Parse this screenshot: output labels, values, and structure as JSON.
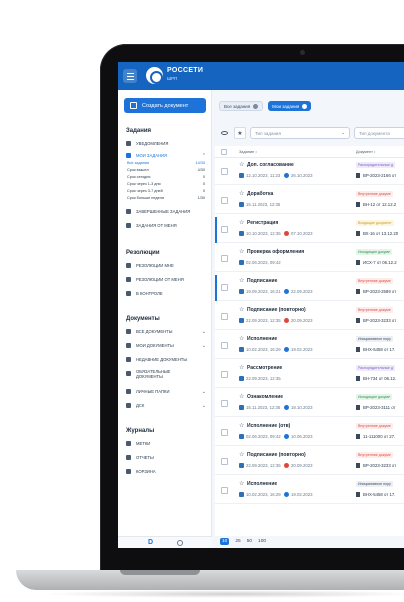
{
  "app": {
    "logo_text": "РОССЕТИ",
    "logo_sub": "ШРП"
  },
  "sidebar": {
    "create_label": "Создать документ",
    "tasks_title": "Задания",
    "notifications": "Уведомления",
    "my_tasks": "Мои задания",
    "subitems": [
      {
        "label": "Все задания",
        "count": "14/33"
      },
      {
        "label": "Срок вышел",
        "count": "4/30"
      },
      {
        "label": "Срок сегодня",
        "count": "0"
      },
      {
        "label": "Срок через 1-3 дня",
        "count": "0"
      },
      {
        "label": "Срок через 3-7 дней",
        "count": "0"
      },
      {
        "label": "Срок больше недели",
        "count": "1/30"
      }
    ],
    "completed_tasks": "Завершенные задания",
    "tasks_from_me": "Задания от меня",
    "resolutions_title": "Резолюции",
    "resolutions_to_me": "Резолюции мне",
    "resolutions_from_me": "Резолюции от меня",
    "on_control": "В контроле",
    "documents_title": "Документы",
    "all_documents": "Все документы",
    "my_documents": "Мои документы",
    "recent_documents": "Недавние документы",
    "mandatory_documents": "Обязательные документы",
    "personal_folders": "Личные папки",
    "dsk": "ДСК",
    "journals_title": "Журналы",
    "marks": "Метки",
    "reports": "Отчеты",
    "trash": "Корзина",
    "footer_letter": "D"
  },
  "main": {
    "chips": [
      {
        "label": "Все задания"
      },
      {
        "label": "Мои задания"
      }
    ],
    "task_type_placeholder": "Тип задания",
    "doc_type_placeholder": "Тип документа",
    "col_task": "Задание",
    "col_document": "Документ",
    "rows": [
      {
        "title": "Доп. согласование",
        "date": "12.10.2023, 11:23",
        "deadline": "26.10.2023",
        "deadline_color": "#1e73d8",
        "tag": "Распорядительные д",
        "tag_color": "#7b5fc7",
        "tag_bg": "#efeaf9",
        "doc": "ВР-2023-2166 от",
        "marked": false
      },
      {
        "title": "Доработка",
        "date": "15.11.2023, 12:35",
        "deadline": "",
        "deadline_color": "",
        "tag": "Внутренние докуме",
        "tag_color": "#d9503f",
        "tag_bg": "#fdeceb",
        "doc": "ВН-12 от 12.12.2",
        "marked": false
      },
      {
        "title": "Регистрация",
        "date": "10.10.2023, 12:35",
        "deadline": "07.10.2023",
        "deadline_color": "#e0463a",
        "tag": "Входящие документ",
        "tag_color": "#c9a227",
        "tag_bg": "#fbf5e1",
        "doc": "ВХ-16 от 13.12.20",
        "marked": true
      },
      {
        "title": "Проверка оформления",
        "date": "02.06.2023, 09:42",
        "deadline": "",
        "deadline_color": "",
        "tag": "Исходящие докуме",
        "tag_color": "#2f8f4e",
        "tag_bg": "#e6f5ea",
        "doc": "ИСХ-7 от 06.12.2",
        "marked": false
      },
      {
        "title": "Подписание",
        "date": "19.09.2023, 16:21",
        "deadline": "22.09.2023",
        "deadline_color": "#1e73d8",
        "tag": "Внутренние докуме",
        "tag_color": "#d9503f",
        "tag_bg": "#fdeceb",
        "doc": "ВР-2023-2589 от",
        "marked": true
      },
      {
        "title": "Подписание (повторно)",
        "date": "22.09.2023, 12:35",
        "deadline": "20.09.2023",
        "deadline_color": "#e0463a",
        "tag": "Внутренние докуме",
        "tag_color": "#d9503f",
        "tag_bg": "#fdeceb",
        "doc": "ВР-2023-3233 от",
        "marked": false
      },
      {
        "title": "Исполнение",
        "date": "10.02.2023, 16:29",
        "deadline": "19.02.2023",
        "deadline_color": "#1e73d8",
        "tag": "Инициативное пору",
        "tag_color": "#3a4a5c",
        "tag_bg": "#eceff3",
        "doc": "ВНХ-5458 от 17.",
        "marked": false
      },
      {
        "title": "Рассмотрение",
        "date": "22.09.2023, 12:35",
        "deadline": "",
        "deadline_color": "",
        "tag": "Распорядительные д",
        "tag_color": "#7b5fc7",
        "tag_bg": "#efeaf9",
        "doc": "ВН-734 от 06.12.",
        "marked": false
      },
      {
        "title": "Ознакомление",
        "date": "15.11.2023, 12:35",
        "deadline": "18.10.2023",
        "deadline_color": "#1e73d8",
        "tag": "Исходящие докуме",
        "tag_color": "#2f8f4e",
        "tag_bg": "#e6f5ea",
        "doc": "ВР-2023-3111 от",
        "marked": false
      },
      {
        "title": "Исполнение (отв)",
        "date": "02.06.2023, 09:42",
        "deadline": "10.06.2023",
        "deadline_color": "#1e73d8",
        "tag": "Внутренние докуме",
        "tag_color": "#d9503f",
        "tag_bg": "#fdeceb",
        "doc": "11-111000 от 27.",
        "marked": false
      },
      {
        "title": "Подписание (повторно)",
        "date": "22.09.2023, 12:35",
        "deadline": "20.09.2023",
        "deadline_color": "#e0463a",
        "tag": "Внутренние докуме",
        "tag_color": "#d9503f",
        "tag_bg": "#fdeceb",
        "doc": "ВР-2023-3233 от",
        "marked": false
      },
      {
        "title": "Исполнение",
        "date": "10.02.2023, 16:29",
        "deadline": "19.02.2023",
        "deadline_color": "#1e73d8",
        "tag": "Инициативное пору",
        "tag_color": "#3a4a5c",
        "tag_bg": "#eceff3",
        "doc": "ВНХ-5458 от 17.",
        "marked": false
      }
    ],
    "page_sizes": [
      "10",
      "25",
      "50",
      "100"
    ]
  },
  "colors": {
    "brand": "#1565c0",
    "accent": "#1e73d8"
  }
}
